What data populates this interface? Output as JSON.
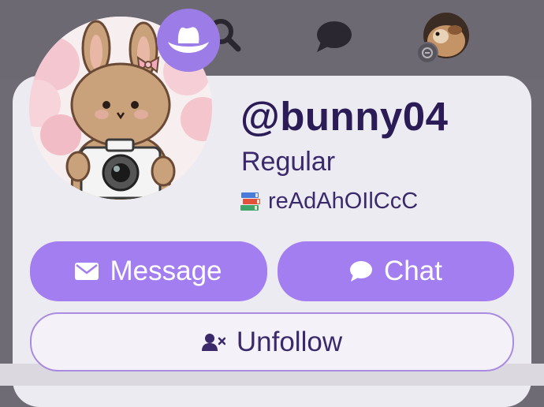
{
  "top_nav": {
    "search_icon": "search-icon",
    "chat_icon": "chat-bubble-icon",
    "avatar_icon": "user-avatar",
    "avatar_badge_icon": "minus-circle-icon"
  },
  "profile": {
    "handle": "@bunny04",
    "rank": "Regular",
    "status_emoji": "books-emoji",
    "status_text": "reAdAhOIlCcC",
    "avatar_badge_icon": "cowboy-hat-icon"
  },
  "actions": {
    "message_label": "Message",
    "message_icon": "envelope-icon",
    "chat_label": "Chat",
    "chat_icon": "chat-bubble-icon",
    "unfollow_label": "Unfollow",
    "unfollow_icon": "user-remove-icon"
  },
  "colors": {
    "accent": "#a37ef0",
    "handle_text": "#2b1b57",
    "card_bg": "#ecebf2"
  }
}
